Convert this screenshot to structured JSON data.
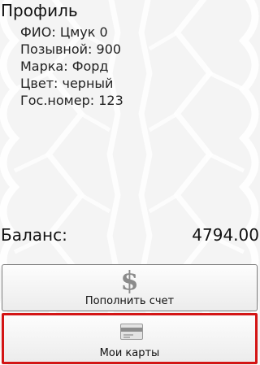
{
  "header": {
    "title": "Профиль"
  },
  "profile": {
    "rows": [
      "ФИО: Цмук 0",
      "Позывной: 900",
      "Марка: Форд",
      "Цвет: черный",
      "Гос.номер: 123"
    ]
  },
  "balance": {
    "label": "Баланс:",
    "value": "4794.00"
  },
  "buttons": {
    "topup": {
      "label": "Пополнить счет",
      "icon": "dollar-icon",
      "icon_glyph": "$"
    },
    "cards": {
      "label": "Мои карты",
      "icon": "credit-card-icon",
      "highlight_color": "#d31515"
    }
  }
}
